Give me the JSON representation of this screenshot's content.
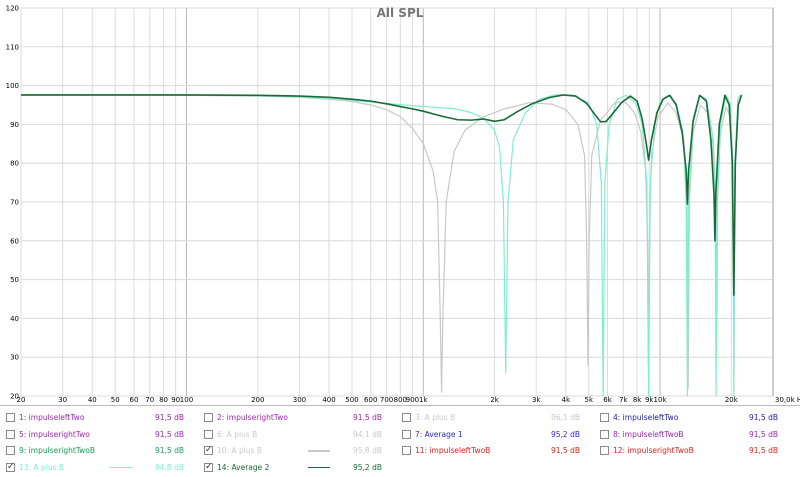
{
  "chart_data": {
    "type": "line",
    "title": "All SPL",
    "x_unit": "Hz",
    "x_scale": "log",
    "x_range": [
      20,
      30000
    ],
    "y_range": [
      20,
      120
    ],
    "grid": true,
    "y_ticks": [
      20,
      30,
      40,
      50,
      60,
      70,
      80,
      90,
      100,
      110,
      120
    ],
    "x_ticks": [
      {
        "v": 20,
        "label": "20"
      },
      {
        "v": 30,
        "label": "30"
      },
      {
        "v": 40,
        "label": "40"
      },
      {
        "v": 50,
        "label": "50"
      },
      {
        "v": 60,
        "label": "60"
      },
      {
        "v": 70,
        "label": "70"
      },
      {
        "v": 80,
        "label": "80"
      },
      {
        "v": 90,
        "label": "90"
      },
      {
        "v": 100,
        "label": "100"
      },
      {
        "v": 200,
        "label": "200"
      },
      {
        "v": 300,
        "label": "300"
      },
      {
        "v": 400,
        "label": "400"
      },
      {
        "v": 500,
        "label": "500"
      },
      {
        "v": 600,
        "label": "600"
      },
      {
        "v": 700,
        "label": "700"
      },
      {
        "v": 800,
        "label": "800"
      },
      {
        "v": 900,
        "label": "900"
      },
      {
        "v": 1000,
        "label": "1k"
      },
      {
        "v": 2000,
        "label": "2k"
      },
      {
        "v": 3000,
        "label": "3k"
      },
      {
        "v": 4000,
        "label": "4k"
      },
      {
        "v": 5000,
        "label": "5k"
      },
      {
        "v": 6000,
        "label": "6k"
      },
      {
        "v": 7000,
        "label": "7k"
      },
      {
        "v": 8000,
        "label": "8k"
      },
      {
        "v": 9000,
        "label": "9k"
      },
      {
        "v": 10000,
        "label": "10k"
      },
      {
        "v": 20000,
        "label": "20k"
      }
    ],
    "x_end_label": "30,0k Hz",
    "series": [
      {
        "name": "10: A plus B",
        "color": "#c8c8c8",
        "points": [
          [
            20,
            97.5
          ],
          [
            100,
            97.5
          ],
          [
            200,
            97.3
          ],
          [
            300,
            97.0
          ],
          [
            400,
            96.5
          ],
          [
            500,
            95.9
          ],
          [
            600,
            95.0
          ],
          [
            700,
            93.8
          ],
          [
            800,
            92.0
          ],
          [
            900,
            89.0
          ],
          [
            1000,
            85.0
          ],
          [
            1100,
            78.0
          ],
          [
            1150,
            70.0
          ],
          [
            1180,
            40.0
          ],
          [
            1195,
            21.0
          ],
          [
            1210,
            40.0
          ],
          [
            1250,
            70.0
          ],
          [
            1350,
            83.0
          ],
          [
            1500,
            88.5
          ],
          [
            1800,
            92.0
          ],
          [
            2200,
            94.0
          ],
          [
            2800,
            95.6
          ],
          [
            3500,
            95.2
          ],
          [
            4000,
            93.8
          ],
          [
            4500,
            90.0
          ],
          [
            4800,
            82.0
          ],
          [
            4900,
            60.0
          ],
          [
            4960,
            28.0
          ],
          [
            5020,
            60.0
          ],
          [
            5150,
            82.0
          ],
          [
            5600,
            91.0
          ],
          [
            6500,
            95.8
          ],
          [
            7200,
            95.5
          ],
          [
            7800,
            93.0
          ],
          [
            8300,
            88.0
          ],
          [
            8700,
            78.0
          ],
          [
            8850,
            60.0
          ],
          [
            8920,
            28.0
          ],
          [
            9000,
            60.0
          ],
          [
            9200,
            82.0
          ],
          [
            9800,
            92.0
          ],
          [
            10800,
            95.5
          ],
          [
            11700,
            93.0
          ],
          [
            12600,
            86.0
          ],
          [
            13000,
            70.0
          ],
          [
            13150,
            22.0
          ],
          [
            13300,
            70.0
          ],
          [
            13800,
            88.0
          ],
          [
            14800,
            95.0
          ],
          [
            15900,
            93.0
          ],
          [
            16800,
            86.0
          ],
          [
            17200,
            70.0
          ],
          [
            17350,
            30.0
          ],
          [
            17500,
            70.0
          ],
          [
            18000,
            88.0
          ],
          [
            19000,
            94.5
          ],
          [
            19800,
            92.0
          ],
          [
            20300,
            80.0
          ],
          [
            20500,
            21.0
          ],
          [
            20700,
            80.0
          ],
          [
            21300,
            95.0
          ],
          [
            21800,
            96.0
          ]
        ]
      },
      {
        "name": "13: A plus B",
        "color": "#7eeed0",
        "points": [
          [
            20,
            97.5
          ],
          [
            100,
            97.5
          ],
          [
            200,
            97.4
          ],
          [
            300,
            97.1
          ],
          [
            400,
            96.7
          ],
          [
            500,
            96.2
          ],
          [
            600,
            95.8
          ],
          [
            700,
            95.4
          ],
          [
            800,
            95.1
          ],
          [
            1000,
            94.6
          ],
          [
            1200,
            94.3
          ],
          [
            1400,
            93.9
          ],
          [
            1600,
            93.0
          ],
          [
            1800,
            91.5
          ],
          [
            2000,
            88.5
          ],
          [
            2100,
            84.0
          ],
          [
            2180,
            70.0
          ],
          [
            2230,
            26.0
          ],
          [
            2280,
            70.0
          ],
          [
            2400,
            86.0
          ],
          [
            2700,
            93.0
          ],
          [
            3100,
            96.5
          ],
          [
            3600,
            97.6
          ],
          [
            4300,
            97.5
          ],
          [
            5000,
            95.5
          ],
          [
            5400,
            90.0
          ],
          [
            5650,
            75.0
          ],
          [
            5750,
            20.0
          ],
          [
            5850,
            75.0
          ],
          [
            6100,
            90.0
          ],
          [
            6600,
            96.5
          ],
          [
            7200,
            97.5
          ],
          [
            7900,
            95.5
          ],
          [
            8400,
            90.0
          ],
          [
            8800,
            75.0
          ],
          [
            8950,
            20.0
          ],
          [
            9100,
            75.0
          ],
          [
            9500,
            90.0
          ],
          [
            10000,
            96.0
          ],
          [
            10800,
            97.5
          ],
          [
            11700,
            95.5
          ],
          [
            12500,
            88.0
          ],
          [
            12900,
            70.0
          ],
          [
            13050,
            20.0
          ],
          [
            13200,
            70.0
          ],
          [
            13800,
            90.0
          ],
          [
            14700,
            97.5
          ],
          [
            15700,
            96.5
          ],
          [
            16600,
            88.0
          ],
          [
            17100,
            70.0
          ],
          [
            17250,
            20.0
          ],
          [
            17400,
            70.0
          ],
          [
            18000,
            90.0
          ],
          [
            19000,
            97.5
          ],
          [
            19800,
            95.5
          ],
          [
            20300,
            80.0
          ],
          [
            20500,
            20.0
          ],
          [
            20700,
            80.0
          ],
          [
            21300,
            96.5
          ],
          [
            21800,
            97.5
          ]
        ]
      },
      {
        "name": "14: Average 2",
        "color": "#1a6a38",
        "points": [
          [
            20,
            97.6
          ],
          [
            100,
            97.6
          ],
          [
            200,
            97.5
          ],
          [
            300,
            97.3
          ],
          [
            400,
            97.0
          ],
          [
            500,
            96.5
          ],
          [
            600,
            96.0
          ],
          [
            700,
            95.3
          ],
          [
            800,
            94.6
          ],
          [
            900,
            94.0
          ],
          [
            1000,
            93.4
          ],
          [
            1200,
            92.1
          ],
          [
            1400,
            91.2
          ],
          [
            1600,
            91.1
          ],
          [
            1800,
            91.4
          ],
          [
            2000,
            90.8
          ],
          [
            2200,
            91.2
          ],
          [
            2500,
            93.3
          ],
          [
            2900,
            95.4
          ],
          [
            3400,
            96.9
          ],
          [
            3900,
            97.6
          ],
          [
            4400,
            97.3
          ],
          [
            4900,
            95.4
          ],
          [
            5300,
            92.6
          ],
          [
            5600,
            90.7
          ],
          [
            5900,
            90.7
          ],
          [
            6300,
            92.7
          ],
          [
            6900,
            95.7
          ],
          [
            7500,
            97.3
          ],
          [
            8000,
            96.0
          ],
          [
            8400,
            91.5
          ],
          [
            8750,
            85.0
          ],
          [
            8950,
            80.8
          ],
          [
            9200,
            86.0
          ],
          [
            9700,
            93.0
          ],
          [
            10300,
            96.5
          ],
          [
            11000,
            97.5
          ],
          [
            11700,
            95.0
          ],
          [
            12400,
            88.0
          ],
          [
            12900,
            78.0
          ],
          [
            13050,
            69.5
          ],
          [
            13200,
            78.0
          ],
          [
            13800,
            91.0
          ],
          [
            14700,
            97.5
          ],
          [
            15700,
            96.0
          ],
          [
            16400,
            86.0
          ],
          [
            16900,
            72.0
          ],
          [
            17050,
            60.0
          ],
          [
            17200,
            72.0
          ],
          [
            17800,
            90.0
          ],
          [
            18800,
            97.5
          ],
          [
            19600,
            95.0
          ],
          [
            20200,
            80.0
          ],
          [
            20500,
            46.0
          ],
          [
            20800,
            80.0
          ],
          [
            21400,
            95.0
          ],
          [
            22100,
            97.6
          ]
        ]
      }
    ]
  },
  "legend": {
    "rows": [
      [
        {
          "label": "1: impulseleftTwo",
          "value": "91,5 dB",
          "color": "#9a2aa8",
          "checked": false,
          "dim": false
        },
        {
          "label": "2: impulserightTwo",
          "value": "91,5 dB",
          "color": "#9a2aa8",
          "checked": false,
          "dim": false
        },
        {
          "label": "3: A plus B",
          "value": "96,1 dB",
          "color": "#c8c8c8",
          "checked": false,
          "dim": true
        },
        {
          "label": "4: impulseleftTwo",
          "value": "91,5 dB",
          "color": "#1e1e9a",
          "checked": false,
          "dim": false
        }
      ],
      [
        {
          "label": "5: impulserightTwo",
          "value": "91,5 dB",
          "color": "#9a2aa8",
          "checked": false,
          "dim": false
        },
        {
          "label": "6: A plus B",
          "value": "94,1 dB",
          "color": "#c8c8c8",
          "checked": false,
          "dim": true
        },
        {
          "label": "7: Average 1",
          "value": "95,2 dB",
          "color": "#2a2ad0",
          "checked": false,
          "dim": false
        },
        {
          "label": "8: impulseleftTwoB",
          "value": "91,5 dB",
          "color": "#9a2aa8",
          "checked": false,
          "dim": false
        }
      ],
      [
        {
          "label": "9: impulserightTwoB",
          "value": "91,5 dB",
          "color": "#1a9a5a",
          "checked": false,
          "dim": false
        },
        {
          "label": "10: A plus B",
          "value": "95,8 dB",
          "color": "#c8c8c8",
          "checked": true,
          "dim": true,
          "swatch": "#c8c8c8"
        },
        {
          "label": "11: impulseleftTwoB",
          "value": "91,5 dB",
          "color": "#e02020",
          "checked": false,
          "dim": false
        },
        {
          "label": "12: impulserightTwoB",
          "value": "91,5 dB",
          "color": "#e02020",
          "checked": false,
          "dim": false
        }
      ],
      [
        {
          "label": "13: A plus B",
          "value": "94,8 dB",
          "color": "#7eeed0",
          "checked": true,
          "dim": true,
          "swatch": "#7eeed0"
        },
        {
          "label": "14: Average 2",
          "value": "95,2 dB",
          "color": "#1a6a38",
          "checked": true,
          "dim": false,
          "swatch": "#1a6a38"
        }
      ]
    ],
    "check_glyph": "✓"
  }
}
